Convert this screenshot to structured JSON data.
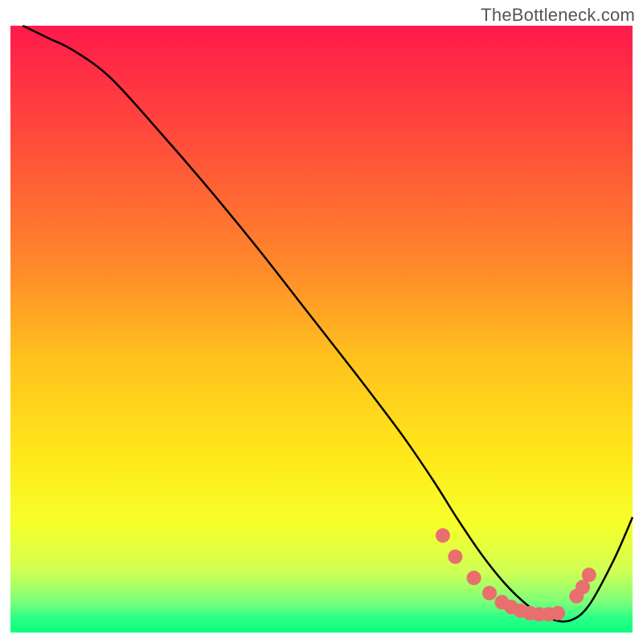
{
  "attribution": "TheBottleneck.com",
  "chart_data": {
    "type": "line",
    "title": "",
    "xlabel": "",
    "ylabel": "",
    "xlim": [
      0,
      100
    ],
    "ylim": [
      0,
      100
    ],
    "background": {
      "type": "vertical-gradient",
      "stops": [
        {
          "offset": 0.0,
          "color": "#ff1a4b"
        },
        {
          "offset": 0.2,
          "color": "#ff4f3a"
        },
        {
          "offset": 0.4,
          "color": "#ff8a2a"
        },
        {
          "offset": 0.55,
          "color": "#ffc21e"
        },
        {
          "offset": 0.7,
          "color": "#ffe61a"
        },
        {
          "offset": 0.82,
          "color": "#f6ff2a"
        },
        {
          "offset": 0.9,
          "color": "#d0ff55"
        },
        {
          "offset": 0.95,
          "color": "#7aff7a"
        },
        {
          "offset": 0.975,
          "color": "#2dff88"
        },
        {
          "offset": 1.0,
          "color": "#0cff7e"
        }
      ]
    },
    "series": [
      {
        "name": "curve",
        "color": "#000000",
        "stroke_width": 2,
        "x": [
          2,
          6,
          10,
          16,
          24,
          32,
          40,
          48,
          56,
          63,
          68,
          72,
          76,
          80,
          84,
          87,
          90,
          93,
          97,
          100
        ],
        "y": [
          100,
          98,
          96,
          91.5,
          82.5,
          73,
          63,
          52.5,
          42,
          32.5,
          25,
          18.5,
          12.5,
          7.5,
          3.8,
          2.2,
          2.0,
          4.5,
          12,
          19
        ]
      }
    ],
    "markers": {
      "name": "dots",
      "color": "#e96f6f",
      "radius_px": 9,
      "x": [
        69.5,
        71.5,
        74.5,
        77.0,
        79.0,
        80.5,
        82.0,
        83.5,
        85.0,
        86.5,
        88.0,
        91.0,
        92.0,
        93.0
      ],
      "y": [
        16.0,
        12.5,
        9.0,
        6.5,
        5.0,
        4.2,
        3.6,
        3.2,
        3.0,
        3.0,
        3.2,
        6.0,
        7.5,
        9.5
      ]
    }
  }
}
